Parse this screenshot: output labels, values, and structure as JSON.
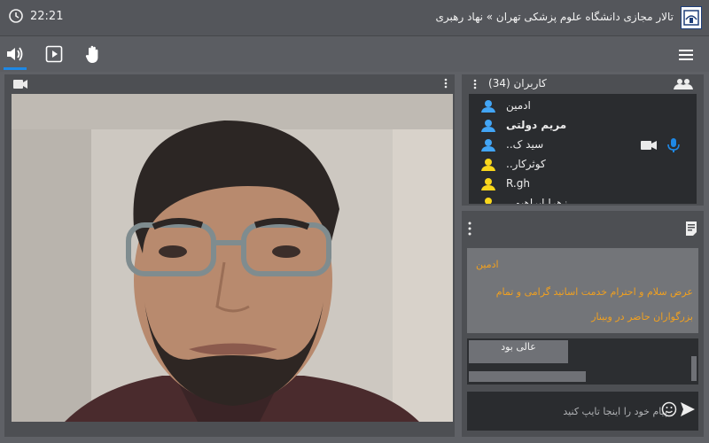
{
  "header": {
    "time": "22:21",
    "title": "تالار مجازی دانشگاه علوم پزشکی تهران » نهاد رهبری"
  },
  "toolbar": {
    "icons": [
      "speaker-icon",
      "play-icon",
      "hand-icon",
      "menu-icon"
    ]
  },
  "users": {
    "title": "کاربران (34)",
    "items": [
      {
        "name": "ادمین",
        "role": "admin",
        "bold": false
      },
      {
        "name": "مریم دولتی",
        "role": "admin",
        "bold": true
      },
      {
        "name": "سید ک..",
        "role": "admin",
        "bold": false
      },
      {
        "name": "کوثرکار..",
        "role": "user",
        "bold": false
      },
      {
        "name": "R.gh",
        "role": "user",
        "bold": false
      },
      {
        "name": "زهرا ابراهیمی",
        "role": "user",
        "bold": false
      }
    ]
  },
  "chat": {
    "author": "ادمین",
    "message": "عرض سلام و احترام خدمت اساتید گرامی و تمام بزرگواران حاضر در وبینار",
    "reply": "عالی بود",
    "placeholder": "پیام خود را اینجا تایپ کنید"
  },
  "colors": {
    "accent": "#1e88e5",
    "admin_icon": "#42a5f5",
    "user_icon": "#f9d71c",
    "chat_text": "#f0a020"
  }
}
